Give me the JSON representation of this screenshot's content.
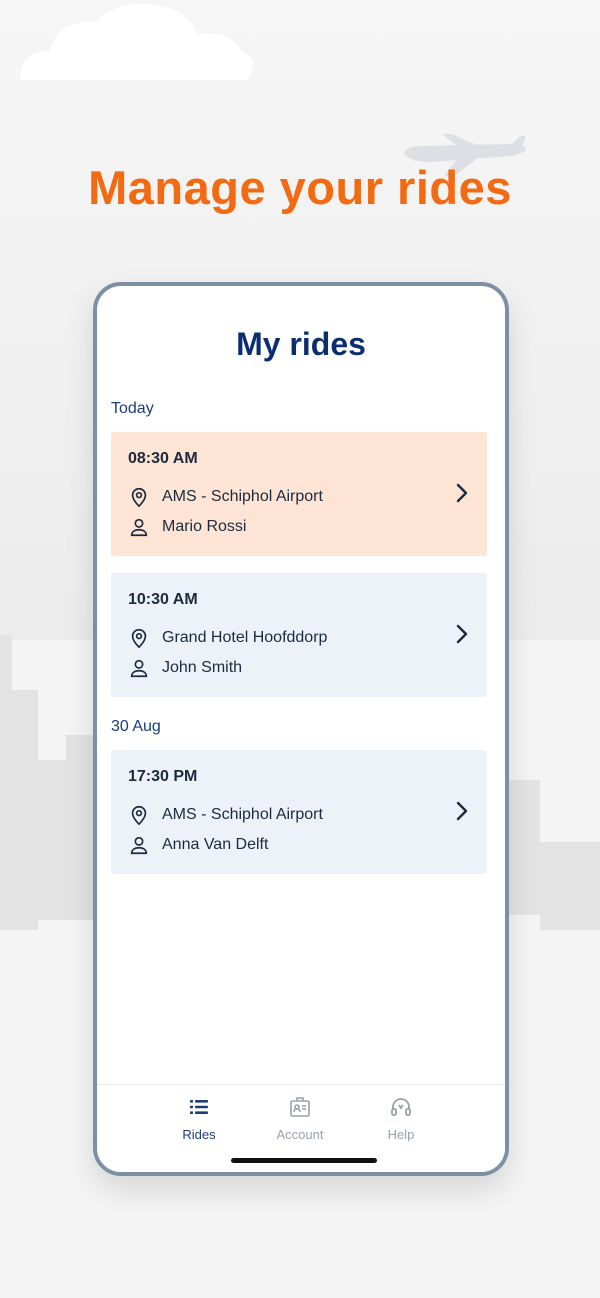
{
  "headline": "Manage your rides",
  "screen": {
    "title": "My rides"
  },
  "sections": [
    {
      "label": "Today",
      "rides": [
        {
          "time": "08:30 AM",
          "place": "AMS - Schiphol Airport",
          "person": "Mario Rossi",
          "highlight": true
        },
        {
          "time": "10:30 AM",
          "place": "Grand Hotel Hoofddorp",
          "person": "John Smith",
          "highlight": false
        }
      ]
    },
    {
      "label": "30 Aug",
      "rides": [
        {
          "time": "17:30 PM",
          "place": "AMS - Schiphol Airport",
          "person": "Anna Van Delft",
          "highlight": false
        }
      ]
    }
  ],
  "tabbar": {
    "tabs": [
      {
        "label": "Rides",
        "icon": "list-icon",
        "active": true
      },
      {
        "label": "Account",
        "icon": "id-card-icon",
        "active": false
      },
      {
        "label": "Help",
        "icon": "headset-icon",
        "active": false
      }
    ]
  },
  "colors": {
    "accent": "#f26b12",
    "brand": "#0d2e6e",
    "highlight_card": "#fde4d4",
    "card": "#edf2f8"
  }
}
